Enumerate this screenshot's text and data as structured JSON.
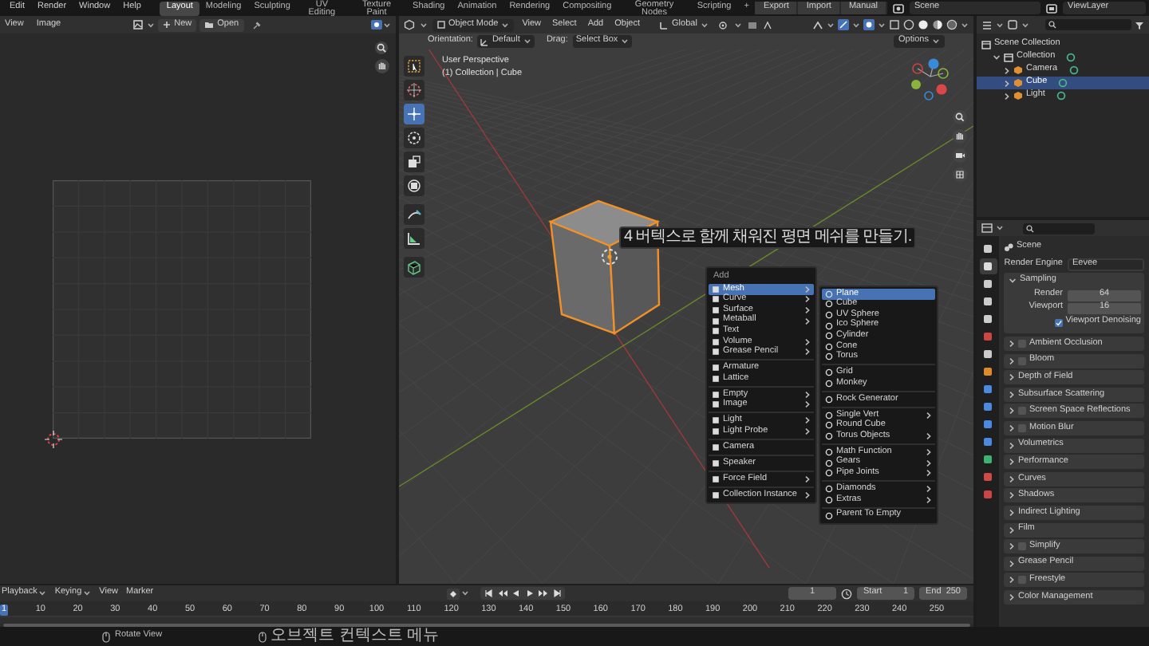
{
  "top_bar": {
    "menus": [
      "Edit",
      "Render",
      "Window",
      "Help"
    ],
    "workspaces": [
      {
        "label": "Layout",
        "selected": true
      },
      {
        "label": "Modeling",
        "selected": false
      },
      {
        "label": "Sculpting",
        "selected": false
      },
      {
        "label": "UV Editing",
        "selected": false
      },
      {
        "label": "Texture Paint",
        "selected": false
      },
      {
        "label": "Shading",
        "selected": false
      },
      {
        "label": "Animation",
        "selected": false
      },
      {
        "label": "Rendering",
        "selected": false
      },
      {
        "label": "Compositing",
        "selected": false
      },
      {
        "label": "Geometry Nodes",
        "selected": false
      },
      {
        "label": "Scripting",
        "selected": false
      }
    ],
    "add_workspace": "+",
    "buttons": [
      "Export",
      "Import",
      "Manual"
    ],
    "scene": "Scene",
    "view_layer": "ViewLayer"
  },
  "image_editor": {
    "menus": [
      "View",
      "Image"
    ],
    "new_button": "New",
    "open_button": "Open"
  },
  "viewport": {
    "mode": "Object Mode",
    "menus": [
      "View",
      "Select",
      "Add",
      "Object"
    ],
    "transform_orientation": "Global",
    "orientation_label": "Orientation:",
    "orientation": "Default",
    "drag_label": "Drag:",
    "drag": "Select Box",
    "options": "Options",
    "overlay_lines": [
      "User Perspective",
      "(1) Collection | Cube"
    ],
    "tools": [
      {
        "selected": false
      },
      {
        "selected": false
      },
      {
        "selected": true
      },
      {
        "selected": false
      },
      {
        "selected": false
      },
      {
        "selected": false
      },
      {
        "selected": false
      },
      {
        "selected": false
      },
      {
        "selected": false
      }
    ]
  },
  "add_menu": {
    "title": "Add",
    "sections": [
      [
        {
          "label": "Mesh",
          "submenu": true,
          "selected": true
        },
        {
          "label": "Curve",
          "submenu": true,
          "selected": false
        },
        {
          "label": "Surface",
          "submenu": true,
          "selected": false
        },
        {
          "label": "Metaball",
          "submenu": true,
          "selected": false
        },
        {
          "label": "Text",
          "submenu": false,
          "selected": false
        },
        {
          "label": "Volume",
          "submenu": true,
          "selected": false
        },
        {
          "label": "Grease Pencil",
          "submenu": true,
          "selected": false
        }
      ],
      [
        {
          "label": "Armature",
          "submenu": false,
          "selected": false
        },
        {
          "label": "Lattice",
          "submenu": false,
          "selected": false
        }
      ],
      [
        {
          "label": "Empty",
          "submenu": true,
          "selected": false
        },
        {
          "label": "Image",
          "submenu": true,
          "selected": false
        }
      ],
      [
        {
          "label": "Light",
          "submenu": true,
          "selected": false
        },
        {
          "label": "Light Probe",
          "submenu": true,
          "selected": false
        }
      ],
      [
        {
          "label": "Camera",
          "submenu": false,
          "selected": false
        }
      ],
      [
        {
          "label": "Speaker",
          "submenu": false,
          "selected": false
        }
      ],
      [
        {
          "label": "Force Field",
          "submenu": true,
          "selected": false
        }
      ],
      [
        {
          "label": "Collection Instance",
          "submenu": true,
          "selected": false
        }
      ]
    ]
  },
  "mesh_menu": {
    "sections": [
      [
        {
          "label": "Plane",
          "submenu": false,
          "selected": true
        },
        {
          "label": "Cube",
          "submenu": false,
          "selected": false
        },
        {
          "label": "UV Sphere",
          "submenu": false,
          "selected": false
        },
        {
          "label": "Ico Sphere",
          "submenu": false,
          "selected": false
        },
        {
          "label": "Cylinder",
          "submenu": false,
          "selected": false
        },
        {
          "label": "Cone",
          "submenu": false,
          "selected": false
        },
        {
          "label": "Torus",
          "submenu": false,
          "selected": false
        }
      ],
      [
        {
          "label": "Grid",
          "submenu": false,
          "selected": false
        },
        {
          "label": "Monkey",
          "submenu": false,
          "selected": false
        }
      ],
      [
        {
          "label": "Rock Generator",
          "submenu": false,
          "selected": false
        }
      ],
      [
        {
          "label": "Single Vert",
          "submenu": true,
          "selected": false
        },
        {
          "label": "Round Cube",
          "submenu": false,
          "selected": false
        },
        {
          "label": "Torus Objects",
          "submenu": true,
          "selected": false
        }
      ],
      [
        {
          "label": "Math Function",
          "submenu": true,
          "selected": false
        },
        {
          "label": "Gears",
          "submenu": true,
          "selected": false
        },
        {
          "label": "Pipe Joints",
          "submenu": true,
          "selected": false
        }
      ],
      [
        {
          "label": "Diamonds",
          "submenu": true,
          "selected": false
        },
        {
          "label": "Extras",
          "submenu": true,
          "selected": false
        }
      ],
      [
        {
          "label": "Parent To Empty",
          "submenu": false,
          "selected": false
        }
      ]
    ]
  },
  "tooltip": "4 버텍스로 함께 채워진 평면 메쉬를 만들기.",
  "timeline": {
    "menus": [
      {
        "label": "Playback",
        "dropdown": true
      },
      {
        "label": "Keying",
        "dropdown": true
      },
      {
        "label": "View",
        "dropdown": false
      },
      {
        "label": "Marker",
        "dropdown": false
      }
    ],
    "current_frame": "1",
    "start_label": "Start",
    "start": "1",
    "end_label": "End",
    "end": "250",
    "ruler_frame": "1",
    "ticks": [
      "10",
      "20",
      "30",
      "40",
      "50",
      "60",
      "70",
      "80",
      "90",
      "100",
      "110",
      "120",
      "130",
      "140",
      "150",
      "160",
      "170",
      "180",
      "190",
      "200",
      "210",
      "220",
      "230",
      "240",
      "250"
    ]
  },
  "outliner": {
    "items": [
      {
        "label": "Scene Collection",
        "selected": false,
        "children": [
          {
            "label": "Collection",
            "selected": false,
            "expanded": true,
            "children": [
              {
                "label": "Camera",
                "selected": false,
                "expanded": false
              },
              {
                "label": "Cube",
                "selected": true,
                "expanded": false
              },
              {
                "label": "Light",
                "selected": false,
                "expanded": false
              }
            ]
          }
        ]
      }
    ]
  },
  "properties": {
    "tabs": [
      {
        "selected": false
      },
      {
        "selected": true
      },
      {
        "selected": false
      },
      {
        "selected": false
      },
      {
        "selected": false
      },
      {
        "selected": false
      },
      {
        "selected": false
      },
      {
        "selected": false
      },
      {
        "selected": false
      },
      {
        "selected": false
      },
      {
        "selected": false
      },
      {
        "selected": false
      },
      {
        "selected": false
      },
      {
        "selected": false
      },
      {
        "selected": false
      }
    ],
    "context": "Scene",
    "render_engine_label": "Render Engine",
    "render_engine": "Eevee",
    "sampling": {
      "title": "Sampling",
      "expanded": true,
      "fields": [
        {
          "label": "Render",
          "value": "64"
        },
        {
          "label": "Viewport",
          "value": "16"
        }
      ],
      "denoising": {
        "label": "Viewport Denoising",
        "checked": true
      }
    },
    "panels": [
      {
        "label": "Ambient Occlusion",
        "kind": "toggle",
        "checked": false
      },
      {
        "label": "Bloom",
        "kind": "toggle",
        "checked": false
      },
      {
        "label": "Depth of Field",
        "kind": "plain"
      },
      {
        "label": "Subsurface Scattering",
        "kind": "plain"
      },
      {
        "label": "Screen Space Reflections",
        "kind": "toggle",
        "checked": false
      },
      {
        "label": "Motion Blur",
        "kind": "toggle",
        "checked": false
      },
      {
        "label": "Volumetrics",
        "kind": "plain"
      },
      {
        "label": "Performance",
        "kind": "plain"
      },
      {
        "label": "Curves",
        "kind": "plain"
      },
      {
        "label": "Shadows",
        "kind": "plain"
      },
      {
        "label": "Indirect Lighting",
        "kind": "plain"
      },
      {
        "label": "Film",
        "kind": "plain"
      },
      {
        "label": "Simplify",
        "kind": "toggle",
        "checked": false
      },
      {
        "label": "Grease Pencil",
        "kind": "plain"
      },
      {
        "label": "Freestyle",
        "kind": "toggle",
        "checked": false
      },
      {
        "label": "Color Management",
        "kind": "plain"
      }
    ]
  },
  "status_bar": [
    {
      "text": "Rotate View"
    },
    {
      "text": "오브젝트 컨텍스트 메뉴"
    }
  ]
}
